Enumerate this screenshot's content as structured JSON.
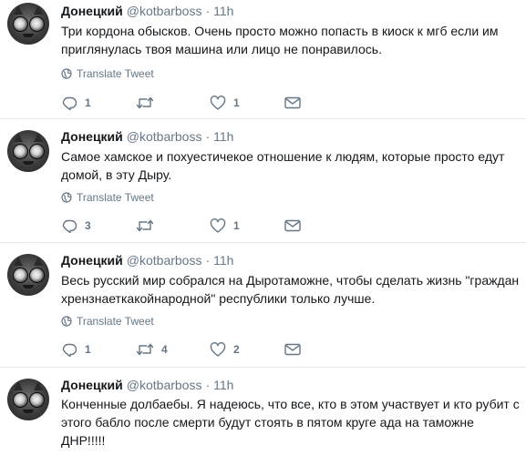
{
  "tweets": [
    {
      "name": "Донецкий",
      "handle": "@kotbarboss",
      "time": "11h",
      "text": "Три кордона обысков. Очень просто можно попасть в киоск к мгб если им приглянулась твоя машина или лицо не понравилось.",
      "translate_label": "Translate Tweet",
      "reply_count": "1",
      "retweet_count": "",
      "like_count": "1"
    },
    {
      "name": "Донецкий",
      "handle": "@kotbarboss",
      "time": "11h",
      "text": "Самое хамское и похуестичекое отношение к людям, которые просто едут домой, в эту Дыру.",
      "translate_label": "Translate Tweet",
      "reply_count": "3",
      "retweet_count": "",
      "like_count": "1"
    },
    {
      "name": "Донецкий",
      "handle": "@kotbarboss",
      "time": "11h",
      "text": "Весь русский мир собрался на Дыротаможне, чтобы сделать жизнь \"граждан хрензнаеткакойнародной\" республики только лучше.",
      "translate_label": "Translate Tweet",
      "reply_count": "1",
      "retweet_count": "4",
      "like_count": "2"
    },
    {
      "name": "Донецкий",
      "handle": "@kotbarboss",
      "time": "11h",
      "text": "Конченные долбаебы. Я надеюсь, что все, кто в этом участвует и кто рубит с этого бабло после смерти будут стоять в пятом круге ада на таможне ДНР!!!!!"
    }
  ],
  "separator": "·",
  "colors": {
    "text": "#14171a",
    "secondary": "#657786",
    "divider": "#e6ecf0",
    "background": "#ffffff"
  },
  "icons": {
    "reply": "reply-icon",
    "retweet": "retweet-icon",
    "like": "heart-icon",
    "dm": "envelope-icon",
    "translate": "globe-icon"
  }
}
